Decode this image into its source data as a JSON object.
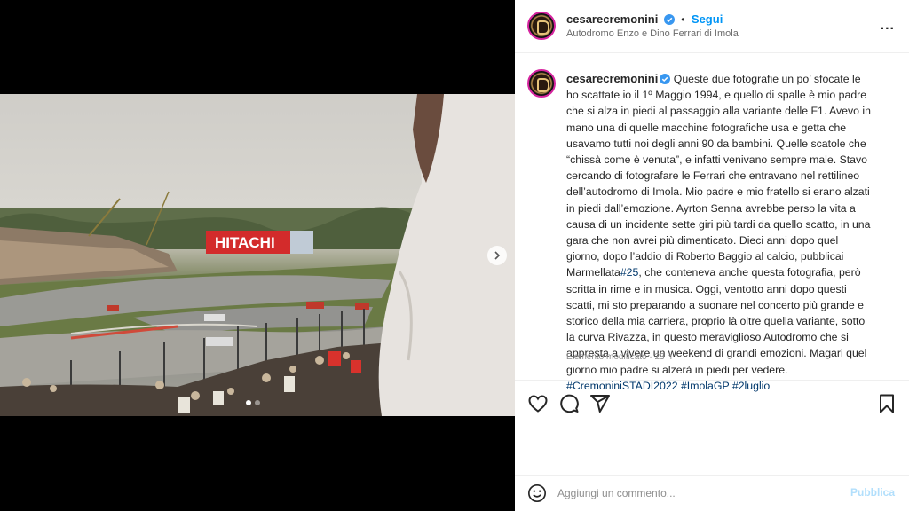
{
  "post": {
    "username": "cesarecremonini",
    "follow_label": "Segui",
    "separator": "•",
    "location": "Autodromo Enzo e Dino Ferrari di Imola",
    "more_label": "...",
    "photo_billboard": "HITACHI"
  },
  "caption": {
    "username": "cesarecremonini",
    "text_before_tag": " Queste due fotografie un po’ sfocate le ho scattate io il 1º Maggio 1994, e quello di spalle è mio padre che si alza in piedi al passaggio alla variante delle F1. Avevo in mano una di quelle macchine fotografiche usa e getta che usavamo tutti noi degli anni 90 da bambini. Quelle scatole che “chissà come è venuta”, e infatti venivano sempre male. Stavo cercando di fotografare le Ferrari che entravano nel rettilineo dell’autodromo di Imola. Mio padre e mio fratello si erano alzati in piedi dall’emozione. Ayrton Senna avrebbe perso la vita a causa di un incidente sette giri più tardi da quello scatto, in una gara che non avrei più dimenticato. Dieci anni dopo quel giorno, dopo l’addio di Roberto Baggio al calcio, pubblicai Marmellata",
    "tag_25": "#25",
    "text_after_tag": ", che conteneva anche questa fotografia, però scritta in rime e in musica. Oggi, ventotto anni dopo questi scatti, mi sto preparando a suonare nel concerto più grande e storico della mia carriera, proprio là oltre quella variante, sotto la curva Rivazza, in questo meraviglioso Autodromo che si appresta a vivere un weekend di grandi emozioni. Magari quel giorno mio padre si alzerà in piedi per vedere. ",
    "hashtags": [
      "#CremoniniSTADI2022",
      "#ImolaGP",
      "#2luglio"
    ],
    "edited": "Elemento modificato · 23 h"
  },
  "carousel": {
    "count": 2,
    "active": 1
  },
  "comment": {
    "placeholder": "Aggiungi un commento...",
    "publish_label": "Pubblica"
  },
  "colors": {
    "accent": "#0095f6",
    "publish_disabled": "#b2dffc",
    "hashtag": "#00376b"
  }
}
